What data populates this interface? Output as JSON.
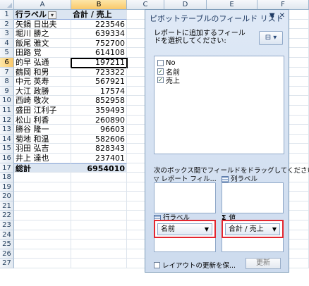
{
  "sheet": {
    "columns": [
      "A",
      "B",
      "C",
      "D",
      "E",
      "F"
    ],
    "selected_column": "B",
    "selected_row": "6",
    "row_numbers": [
      "1",
      "2",
      "3",
      "4",
      "5",
      "6",
      "7",
      "8",
      "9",
      "10",
      "11",
      "12",
      "13",
      "14",
      "15",
      "16",
      "17",
      "18",
      "19",
      "20",
      "21",
      "22",
      "23",
      "24",
      "25",
      "26",
      "27"
    ],
    "pivot_header": {
      "row_label": "行ラベル",
      "value_label": "合計 / 売上",
      "filter_icon": "filter-dropdown-icon"
    },
    "rows": [
      {
        "name": "矢鍋 日出夫",
        "value": "223546"
      },
      {
        "name": "堀川 勝之",
        "value": "639334"
      },
      {
        "name": "飯尾 雅文",
        "value": "752700"
      },
      {
        "name": "田路 覚",
        "value": "614108"
      },
      {
        "name": "的早 弘通",
        "value": "197211"
      },
      {
        "name": "鶴岡 和男",
        "value": "723322"
      },
      {
        "name": "中元 英寿",
        "value": "567921"
      },
      {
        "name": "大江 政勝",
        "value": "17574"
      },
      {
        "name": "西崎 敬次",
        "value": "852958"
      },
      {
        "name": "盛田 江利子",
        "value": "359493"
      },
      {
        "name": "松山 利香",
        "value": "260890"
      },
      {
        "name": "勝谷 隆一",
        "value": "96603"
      },
      {
        "name": "菊地 和温",
        "value": "582606"
      },
      {
        "name": "羽田 弘吉",
        "value": "828343"
      },
      {
        "name": "井上 達也",
        "value": "237401"
      }
    ],
    "total": {
      "label": "総計",
      "value": "6954010"
    }
  },
  "pane": {
    "title": "ピボットテーブルのフィールド リスト",
    "dropdown_glyph": "▼",
    "close_glyph": "✕",
    "instruction": "レポートに追加するフィールドを選択してください:",
    "fields": [
      {
        "label": "No",
        "checked": false
      },
      {
        "label": "名前",
        "checked": true
      },
      {
        "label": "売上",
        "checked": true
      }
    ],
    "drag_instruction": "次のボックス間でフィールドをドラッグしてください:",
    "areas": {
      "report_filter": "レポート フィル...",
      "column_labels": "列ラベル",
      "row_labels": "行ラベル",
      "values": "値"
    },
    "row_field": "名前",
    "value_field": "合計 / 売上",
    "defer_label": "レイアウトの更新を保...",
    "update_label": "更新"
  },
  "colors": {
    "highlight_frame": "#e3262f",
    "pivot_header_bg": "#dbe5f1",
    "pane_bg": "#d5e2f2"
  }
}
